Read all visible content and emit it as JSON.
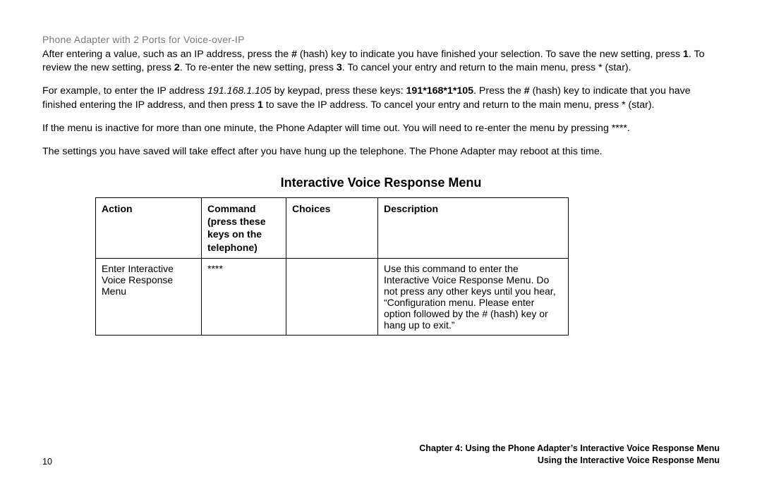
{
  "header": {
    "product_title": "Phone Adapter with 2 Ports for Voice-over-IP"
  },
  "paragraphs": {
    "p1_a": "After entering a value, such as an IP address, press the ",
    "p1_hash": "#",
    "p1_b": " (hash) key to indicate you have finished your selection. To save the new setting, press ",
    "p1_1": "1",
    "p1_c": ". To review the new setting, press ",
    "p1_2": "2",
    "p1_d": ". To re-enter the new setting, press ",
    "p1_3": "3",
    "p1_e": ". To cancel your entry and return to the main menu, press * (star).",
    "p2_a": "For example, to enter the IP address ",
    "p2_ip": "191.168.1.105",
    "p2_b": " by keypad, press these keys: ",
    "p2_keys": "191*168*1*105",
    "p2_c": ". Press the ",
    "p2_hash": "#",
    "p2_d": " (hash) key to indicate that you have finished entering the IP address, and then press ",
    "p2_1": "1",
    "p2_e": " to save the IP address. To cancel your entry and return to the main menu, press * (star).",
    "p3": "If the menu is inactive for more than one minute, the Phone Adapter will time out. You will need to re-enter the menu by pressing ****.",
    "p4": "The settings you have saved will take effect after you have hung up the telephone. The Phone Adapter may reboot at this time."
  },
  "table": {
    "title": "Interactive Voice Response Menu",
    "headers": {
      "action": "Action",
      "command": "Command (press these keys on the telephone)",
      "choices": "Choices",
      "description": "Description"
    },
    "rows": [
      {
        "action": "Enter Interactive Voice Response Menu",
        "command": "****",
        "choices": "",
        "description": "Use this command to enter the Interactive Voice Response Menu. Do not press any other keys until you hear, “Configuration menu. Please enter option followed by the # (hash) key or hang up to exit.”"
      }
    ]
  },
  "footer": {
    "page_number": "10",
    "line1": "Chapter 4: Using the Phone Adapter’s Interactive Voice Response Menu",
    "line2": "Using the Interactive Voice Response Menu"
  }
}
